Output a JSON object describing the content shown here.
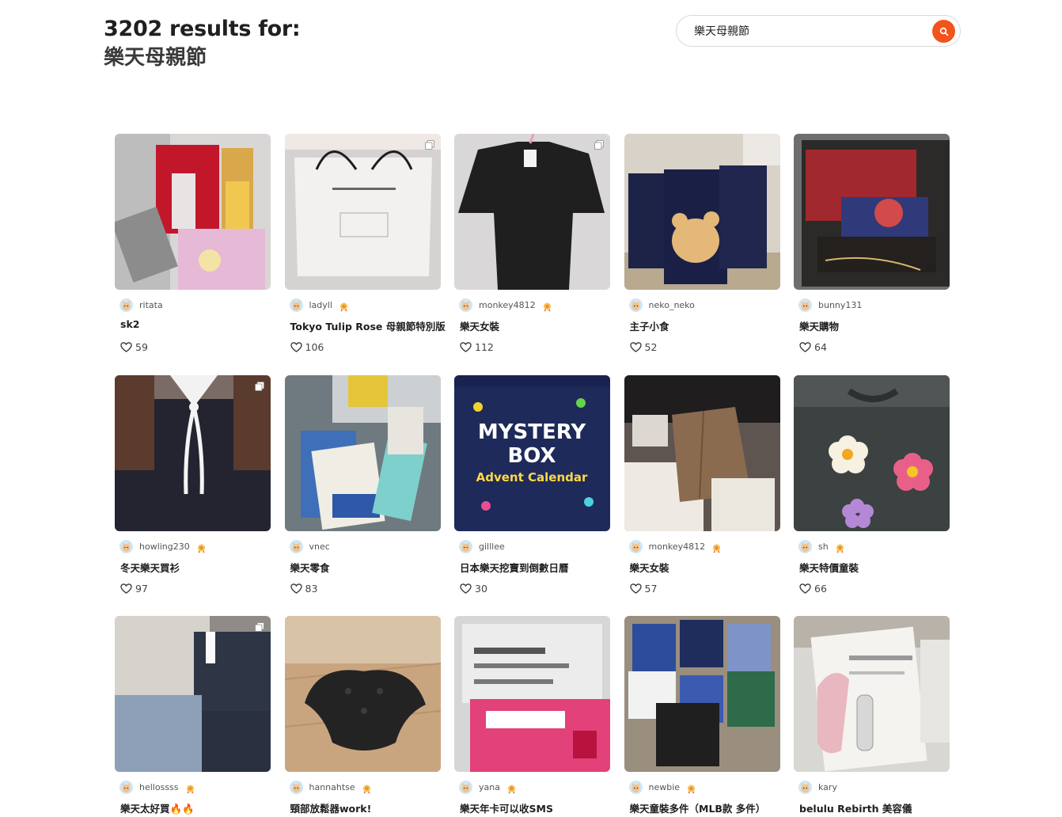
{
  "header": {
    "results_text": "3202 results for:",
    "query": "樂天母親節"
  },
  "search": {
    "value": "樂天母親節",
    "button_icon": "search-icon",
    "accent": "#f2541b"
  },
  "cards": [
    {
      "username": "ritata",
      "badge": false,
      "title": "sk2",
      "likes": "59",
      "multi": false,
      "image": "skincare-products"
    },
    {
      "username": "ladyll",
      "badge": true,
      "title": "Tokyo Tulip Rose 母親節特別版",
      "likes": "106",
      "multi": true,
      "image": "paper-shopping-bag"
    },
    {
      "username": "monkey4812",
      "badge": true,
      "title": "樂天女裝",
      "likes": "112",
      "multi": true,
      "image": "black-ruffle-top"
    },
    {
      "username": "neko_neko",
      "badge": false,
      "title": "主子小食",
      "likes": "52",
      "multi": false,
      "image": "pet-treat-bags"
    },
    {
      "username": "bunny131",
      "badge": false,
      "title": "樂天購物",
      "likes": "64",
      "multi": false,
      "image": "greeting-card"
    },
    {
      "username": "howling230",
      "badge": true,
      "title": "冬天樂天買衫",
      "likes": "97",
      "multi": true,
      "image": "black-cardigan"
    },
    {
      "username": "vnec",
      "badge": false,
      "title": "樂天零食",
      "likes": "83",
      "multi": false,
      "image": "snacks"
    },
    {
      "username": "gilllee",
      "badge": false,
      "title": "日本樂天挖寶到倒數日曆",
      "likes": "30",
      "multi": false,
      "image": "mystery-box"
    },
    {
      "username": "monkey4812",
      "badge": true,
      "title": "樂天女裝",
      "likes": "57",
      "multi": false,
      "image": "brown-vest"
    },
    {
      "username": "sh",
      "badge": true,
      "title": "樂天特價童裝",
      "likes": "66",
      "multi": false,
      "image": "flower-sweater"
    },
    {
      "username": "hellossss",
      "badge": true,
      "title": "樂天太好買🔥🔥",
      "likes": "",
      "multi": true,
      "image": "clothes-pile"
    },
    {
      "username": "hannahtse",
      "badge": true,
      "title": "頸部放鬆器work!",
      "likes": "",
      "multi": false,
      "image": "neck-relaxer"
    },
    {
      "username": "yana",
      "badge": true,
      "title": "樂天年卡可以收SMS",
      "likes": "",
      "multi": false,
      "image": "sim-card"
    },
    {
      "username": "newbie",
      "badge": true,
      "title": "樂天童裝多件（MLB款 多件）",
      "likes": "",
      "multi": false,
      "image": "kids-clothes"
    },
    {
      "username": "kary",
      "badge": false,
      "title": "belulu Rebirth 美容儀",
      "likes": "",
      "multi": false,
      "image": "beauty-device"
    }
  ]
}
